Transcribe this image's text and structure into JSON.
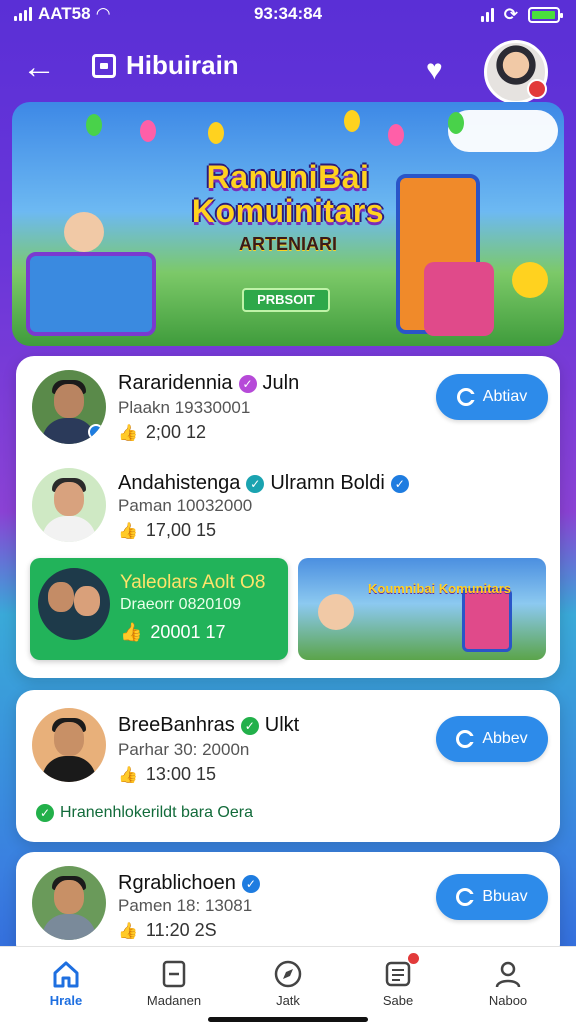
{
  "status": {
    "left_text": "AAT58",
    "center_text": "93:34:84"
  },
  "header": {
    "title": "Hibuirain"
  },
  "banner": {
    "title_line1": "RanuniBai",
    "title_line2": "Komuinitars",
    "subtitle": "ARTENIARI",
    "button": "PRBSOIT"
  },
  "users": [
    {
      "name": "Rararidennia",
      "tag": "Juln",
      "sub": "Plaakn 19330001",
      "stat": "2;00 12",
      "follow": "Abtiav"
    },
    {
      "name": "Andahistenga",
      "tag": "Ulramn Boldi",
      "sub": "Paman 10032000",
      "stat": "17,00 15"
    },
    {
      "name": "BreeBanhras",
      "tag": "Ulkt",
      "sub": "Parhar 30: 2000n",
      "stat": "13:00 15",
      "follow": "Abbev"
    },
    {
      "name": "Rgrablichoen",
      "tag": "",
      "sub": "Pamen 18: 13081",
      "stat": "11:20 2S",
      "follow": "Bbuav"
    }
  ],
  "featured": {
    "title": "Yaleolars Aolt O8",
    "sub": "Draeorr 0820109",
    "stat": "20001 17",
    "thumb_title": "Koumnibai Komunitars"
  },
  "notice": "Hranenhlokerildt bara Oera",
  "nav": [
    {
      "label": "Hrale",
      "active": true
    },
    {
      "label": "Madanen"
    },
    {
      "label": "Jatk"
    },
    {
      "label": "Sabe",
      "dot": true
    },
    {
      "label": "Naboo"
    }
  ],
  "colors": {
    "accent": "#2d8bea",
    "header_bg": "#5a2fd6",
    "green": "#22b35a"
  }
}
